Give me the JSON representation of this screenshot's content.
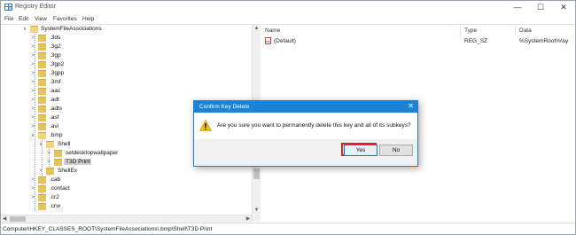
{
  "window": {
    "title": "Registry Editor",
    "minimize": "—",
    "maximize": "☐",
    "close": "✕"
  },
  "menu": [
    "File",
    "Edit",
    "View",
    "Favorites",
    "Help"
  ],
  "tree": {
    "items": [
      {
        "label": "SystemFileAssociations",
        "expander": "∨"
      },
      {
        "label": ".3ds",
        "expander": ">"
      },
      {
        "label": ".3g2",
        "expander": ">"
      },
      {
        "label": ".3gp",
        "expander": ">"
      },
      {
        "label": ".3gp2",
        "expander": ">"
      },
      {
        "label": ".3gpp",
        "expander": ">"
      },
      {
        "label": ".3mf",
        "expander": ">"
      },
      {
        "label": ".aac",
        "expander": ">"
      },
      {
        "label": ".adt",
        "expander": ">"
      },
      {
        "label": ".adts",
        "expander": ">"
      },
      {
        "label": ".asf",
        "expander": ">"
      },
      {
        "label": ".avi",
        "expander": ">"
      },
      {
        "label": ".bmp",
        "expander": "∨"
      },
      {
        "label": "Shell",
        "expander": "∨"
      },
      {
        "label": "setdesktopwallpaper",
        "expander": ">"
      },
      {
        "label": "T3D Print",
        "expander": ">"
      },
      {
        "label": "ShellEx",
        "expander": ">"
      },
      {
        "label": ".cab",
        "expander": ">"
      },
      {
        "label": ".contact",
        "expander": ">"
      },
      {
        "label": ".cr2",
        "expander": ">"
      },
      {
        "label": ".crw",
        "expander": ""
      }
    ]
  },
  "values": {
    "columns": [
      "Name",
      "Type",
      "Data"
    ],
    "rows": [
      {
        "name": "(Default)",
        "type": "REG_SZ",
        "data": "%SystemRoot%\\sy"
      }
    ],
    "icon_text": "ab"
  },
  "status": {
    "path": "Computer\\HKEY_CLASSES_ROOT\\SystemFileAssociations\\.bmp\\Shell\\T3D Print"
  },
  "dialog": {
    "title": "Confirm Key Delete",
    "close": "✕",
    "message": "Are you sure you want to permanently delete this key and all of its subkeys?",
    "yes": "Yes",
    "no": "No"
  },
  "colors": {
    "accent": "#1883d7",
    "highlight": "#e02020",
    "folder": "#e8c25a"
  }
}
